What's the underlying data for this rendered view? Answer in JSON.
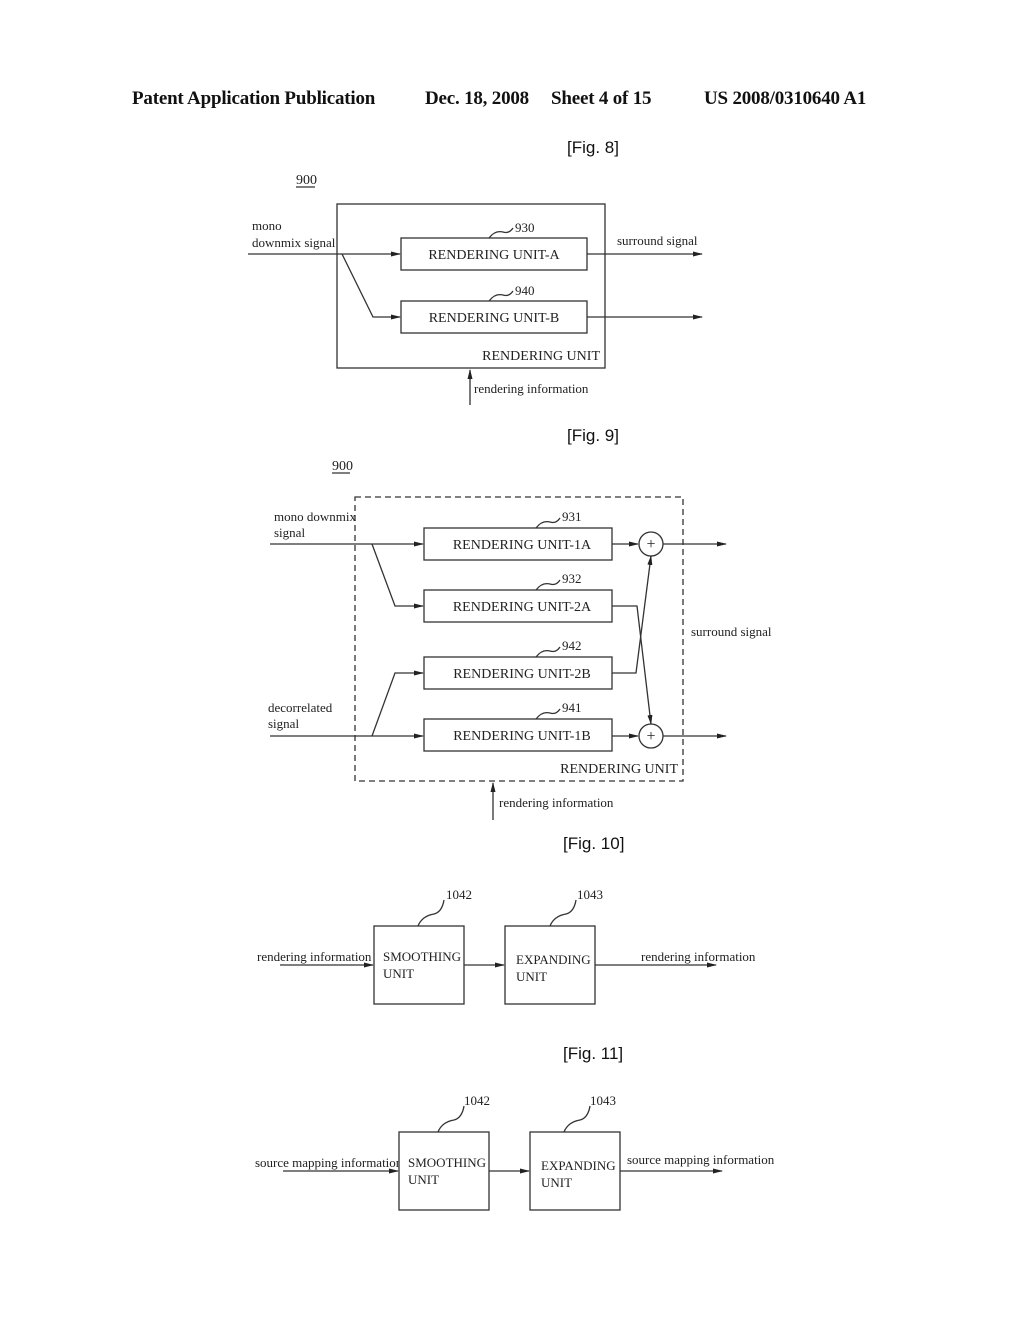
{
  "header": {
    "left": "Patent Application Publication",
    "date": "Dec. 18, 2008",
    "sheet": "Sheet 4 of 15",
    "pub_number": "US 2008/0310640 A1"
  },
  "fig8": {
    "label": "[Fig. 8]",
    "ref": "900",
    "input_line1": "mono",
    "input_line2": "downmix signal",
    "unit_a": {
      "ref": "930",
      "label": "RENDERING UNIT-A"
    },
    "unit_b": {
      "ref": "940",
      "label": "RENDERING UNIT-B"
    },
    "output": "surround signal",
    "container": "RENDERING UNIT",
    "control": "rendering information"
  },
  "fig9": {
    "label": "[Fig. 9]",
    "ref": "900",
    "input1_line1": "mono downmix",
    "input1_line2": "signal",
    "input2_line1": "decorrelated",
    "input2_line2": "signal",
    "unit_1a": {
      "ref": "931",
      "label": "RENDERING UNIT-1A"
    },
    "unit_2a": {
      "ref": "932",
      "label": "RENDERING UNIT-2A"
    },
    "unit_2b": {
      "ref": "942",
      "label": "RENDERING UNIT-2B"
    },
    "unit_1b": {
      "ref": "941",
      "label": "RENDERING UNIT-1B"
    },
    "adder_symbol": "+",
    "output": "surround signal",
    "container": "RENDERING UNIT",
    "control": "rendering information"
  },
  "fig10": {
    "label": "[Fig. 10]",
    "input": "rendering information",
    "smoothing": {
      "ref": "1042",
      "line1": "SMOOTHING",
      "line2": "UNIT"
    },
    "expanding": {
      "ref": "1043",
      "line1": "EXPANDING",
      "line2": "UNIT"
    },
    "output": "rendering information"
  },
  "fig11": {
    "label": "[Fig. 11]",
    "input": "source mapping information",
    "smoothing": {
      "ref": "1042",
      "line1": "SMOOTHING",
      "line2": "UNIT"
    },
    "expanding": {
      "ref": "1043",
      "line1": "EXPANDING",
      "line2": "UNIT"
    },
    "output": "source mapping information"
  }
}
